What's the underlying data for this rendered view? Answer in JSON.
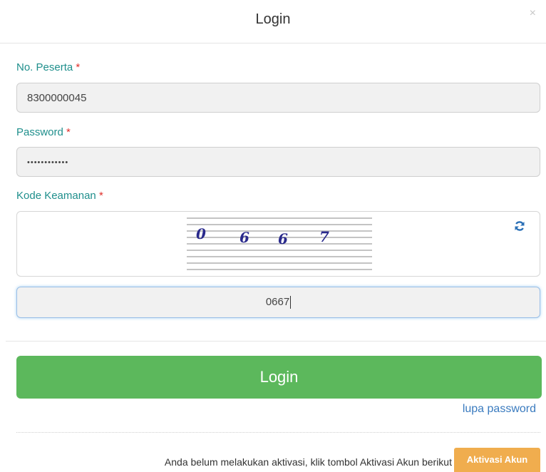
{
  "modal": {
    "title": "Login",
    "close_symbol": "×"
  },
  "form": {
    "peserta_label": "No. Peserta",
    "peserta_value": "8300000045",
    "password_label": "Password",
    "password_value": "••••••••••••",
    "kode_label": "Kode Keamanan",
    "required_marker": "*",
    "captcha_digits": [
      "0",
      "6",
      "6",
      "7"
    ],
    "captcha_input_value": "0667",
    "refresh_icon": "refresh-icon"
  },
  "actions": {
    "login_label": "Login",
    "lupa_label": "lupa password",
    "aktivasi_text": "Anda belum melakukan aktivasi, klik tombol Aktivasi Akun berikut",
    "aktivasi_label": "Aktivasi Akun"
  },
  "colors": {
    "label": "#1f8f8c",
    "required": "#e0302b",
    "login_button": "#5cb85c",
    "aktivasi_button": "#f0ad4e",
    "link": "#3a7bbf"
  }
}
